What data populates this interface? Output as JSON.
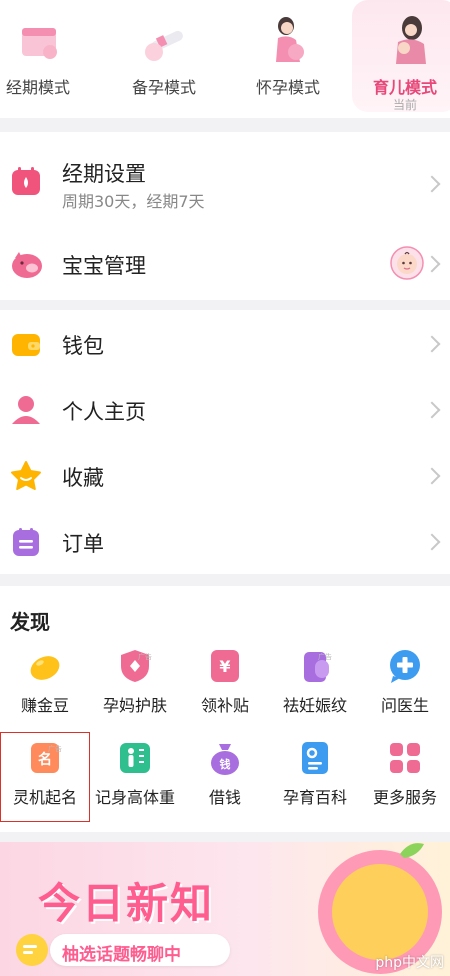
{
  "modes": [
    {
      "label": "经期模式"
    },
    {
      "label": "备孕模式"
    },
    {
      "label": "怀孕模式"
    },
    {
      "label": "育儿模式",
      "sub": "当前"
    }
  ],
  "settings": {
    "period": {
      "title": "经期设置",
      "subtitle": "周期30天，经期7天"
    },
    "baby": {
      "title": "宝宝管理"
    }
  },
  "menu": [
    {
      "label": "钱包"
    },
    {
      "label": "个人主页"
    },
    {
      "label": "收藏"
    },
    {
      "label": "订单"
    }
  ],
  "discover": {
    "title": "发现",
    "items": [
      {
        "label": "赚金豆",
        "ad": ""
      },
      {
        "label": "孕妈护肤",
        "ad": "广告"
      },
      {
        "label": "领补贴",
        "ad": ""
      },
      {
        "label": "祛妊娠纹",
        "ad": "广告"
      },
      {
        "label": "问医生",
        "ad": ""
      },
      {
        "label": "灵机起名",
        "ad": "广告",
        "icon_text": "名"
      },
      {
        "label": "记身高体重",
        "ad": ""
      },
      {
        "label": "借钱",
        "ad": "",
        "icon_text": "钱"
      },
      {
        "label": "孕育百科",
        "ad": ""
      },
      {
        "label": "更多服务",
        "ad": ""
      }
    ]
  },
  "banner": {
    "title": "今日新知",
    "subtitle": "柚选话题畅聊中"
  },
  "watermark": "php中文网",
  "colors": {
    "accent": "#e8477a",
    "selected_outline": "#d8322a"
  }
}
